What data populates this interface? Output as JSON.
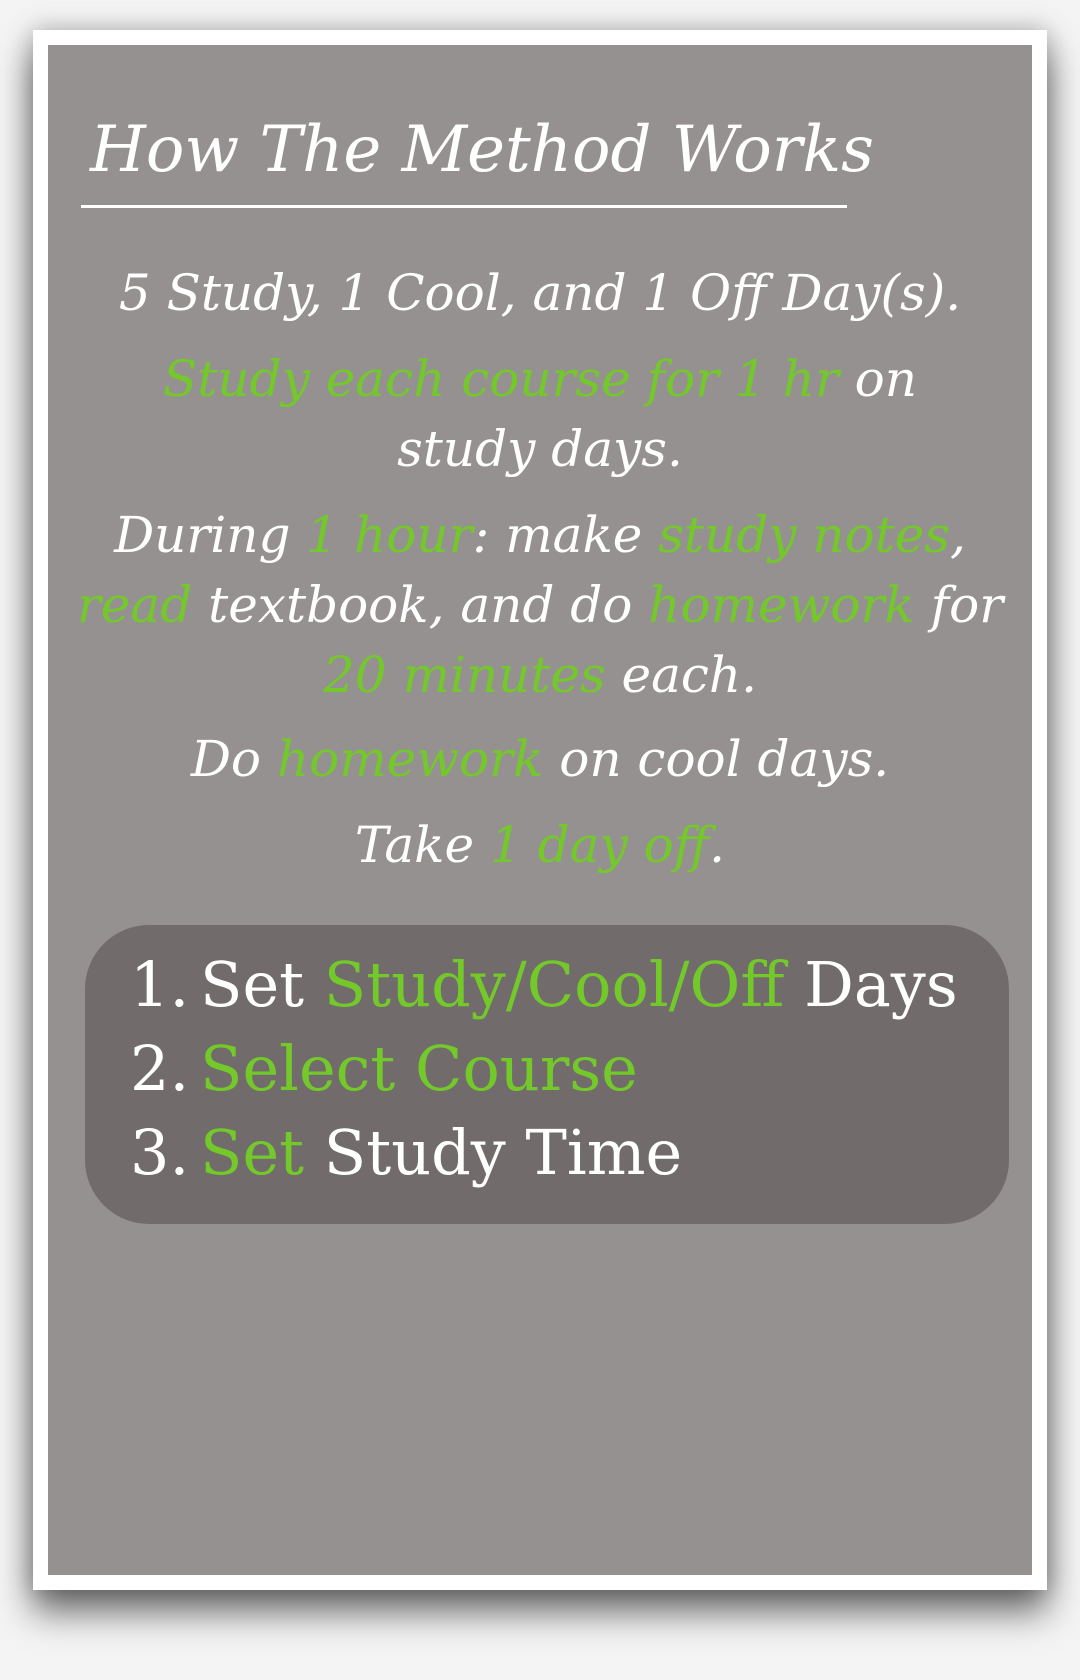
{
  "title": "How The Method Works",
  "colors": {
    "accent": "#74c92a",
    "card": "#959190",
    "panel": "#716c6b",
    "text": "#ffffff"
  },
  "paragraphs": {
    "p1": {
      "text": "5 Study, 1 Cool, and 1 Off Day(s)."
    },
    "p2": {
      "hl1": "Study each course for 1 hr",
      "t1": " on study days."
    },
    "p3": {
      "t1": "During ",
      "hl1": "1 hour",
      "t2": ": make ",
      "hl2": "study notes",
      "t3": ", ",
      "hl3": "read",
      "t4": " textbook, and do ",
      "hl4": "homework",
      "t5": " for ",
      "hl5": "20 minutes",
      "t6": " each."
    },
    "p4": {
      "t1": "Do ",
      "hl1": "homework",
      "t2": " on cool days."
    },
    "p5": {
      "t1": "Take ",
      "hl1": "1 day off",
      "t2": "."
    }
  },
  "steps": [
    {
      "number": "1.",
      "part1": "Set ",
      "highlight": "Study/Cool/Off",
      "part2": " Days"
    },
    {
      "number": "2.",
      "part1": "",
      "highlight": "Select Course",
      "part2": ""
    },
    {
      "number": "3.",
      "part1": "",
      "highlight": "Set",
      "part2": " Study Time"
    }
  ]
}
